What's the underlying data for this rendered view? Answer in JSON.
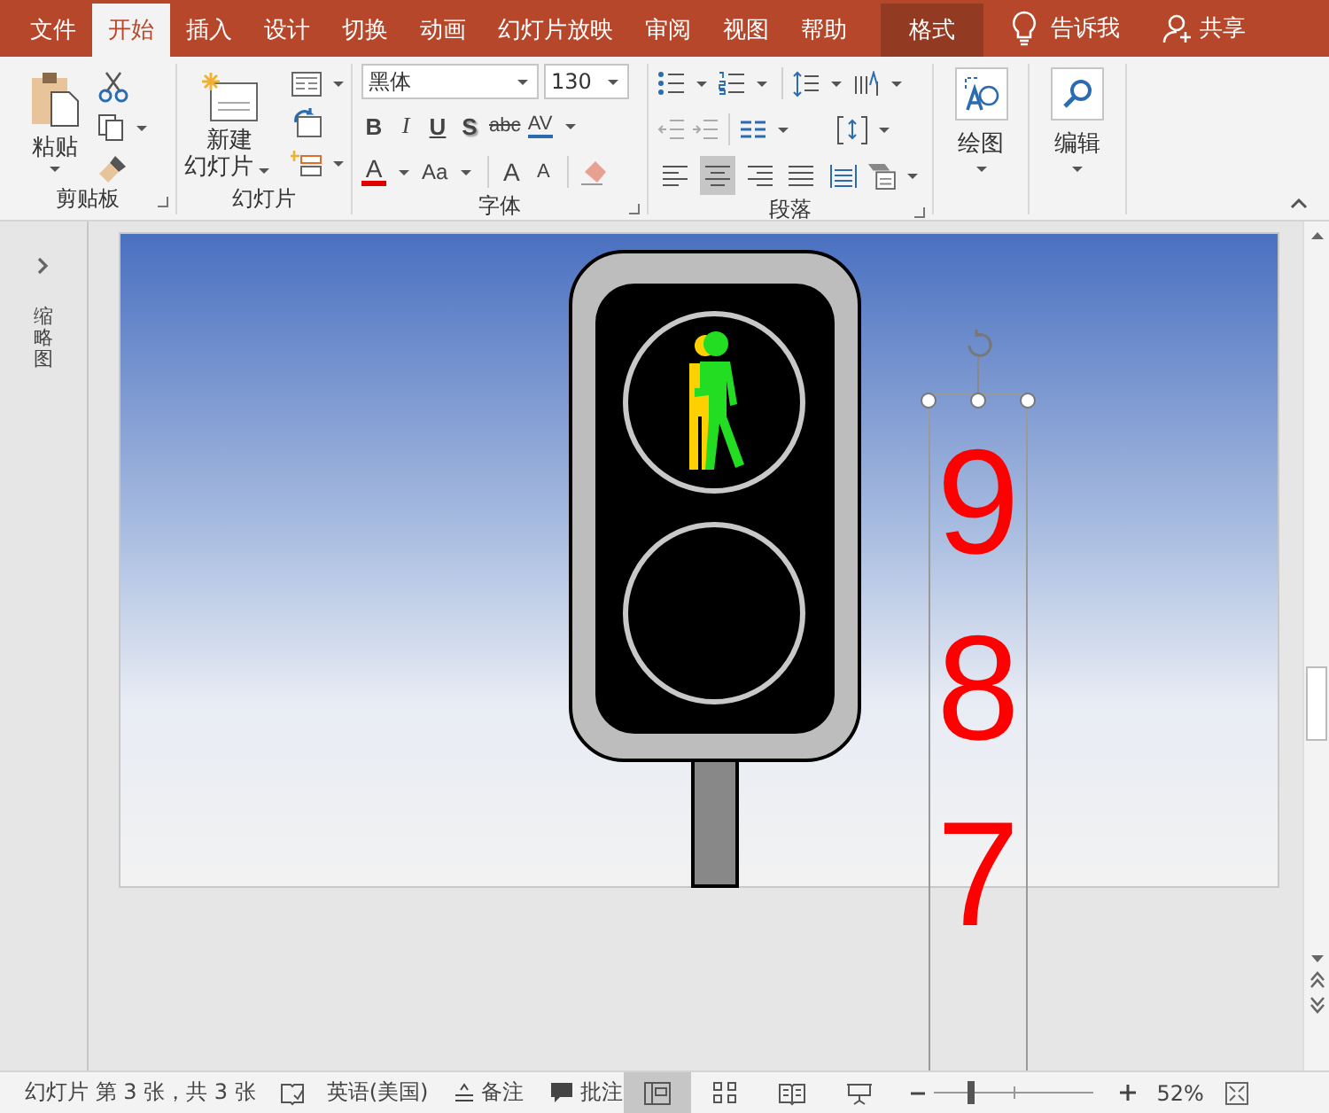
{
  "tabs": [
    {
      "label": "文件",
      "selected": false,
      "kind": "tab"
    },
    {
      "label": "开始",
      "selected": true,
      "kind": "tab"
    },
    {
      "label": "插入",
      "selected": false,
      "kind": "tab"
    },
    {
      "label": "设计",
      "selected": false,
      "kind": "tab"
    },
    {
      "label": "切换",
      "selected": false,
      "kind": "tab"
    },
    {
      "label": "动画",
      "selected": false,
      "kind": "tab"
    },
    {
      "label": "幻灯片放映",
      "selected": false,
      "kind": "tab"
    },
    {
      "label": "审阅",
      "selected": false,
      "kind": "tab"
    },
    {
      "label": "视图",
      "selected": false,
      "kind": "tab"
    },
    {
      "label": "帮助",
      "selected": false,
      "kind": "tab"
    },
    {
      "label": "格式",
      "selected": false,
      "kind": "contextual"
    }
  ],
  "tell_me": "告诉我",
  "share": "共享",
  "ribbon": {
    "clipboard": {
      "title": "剪贴板",
      "paste": "粘贴"
    },
    "slides": {
      "title": "幻灯片",
      "new_slide": [
        "新建",
        "幻灯片"
      ]
    },
    "font": {
      "title": "字体",
      "font_name": "黑体",
      "font_size": "130",
      "style_buttons": [
        "B",
        "I",
        "U",
        "S",
        "abc",
        "AV"
      ],
      "font_color": "A",
      "change_case": "Aa",
      "grow": "A",
      "shrink": "A"
    },
    "paragraph": {
      "title": "段落",
      "alignments": [
        {
          "selected": false
        },
        {
          "selected": true
        },
        {
          "selected": false
        },
        {
          "selected": false
        },
        {
          "selected": false
        }
      ]
    },
    "drawing": {
      "title": "绘图"
    },
    "editing": {
      "title": "编辑"
    }
  },
  "thumbnail_pane": {
    "label": "缩略图"
  },
  "slide": {
    "countdown": [
      "9",
      "8",
      "7"
    ]
  },
  "status_bar": {
    "slide_info": "幻灯片 第 3 张，共 3 张",
    "language": "英语(美国)",
    "notes": "备注",
    "comments": "批注",
    "views": [
      {
        "selected": true
      },
      {
        "selected": false
      },
      {
        "selected": false
      },
      {
        "selected": false
      }
    ],
    "zoom": {
      "level": 0.24,
      "reading": "52%"
    }
  }
}
